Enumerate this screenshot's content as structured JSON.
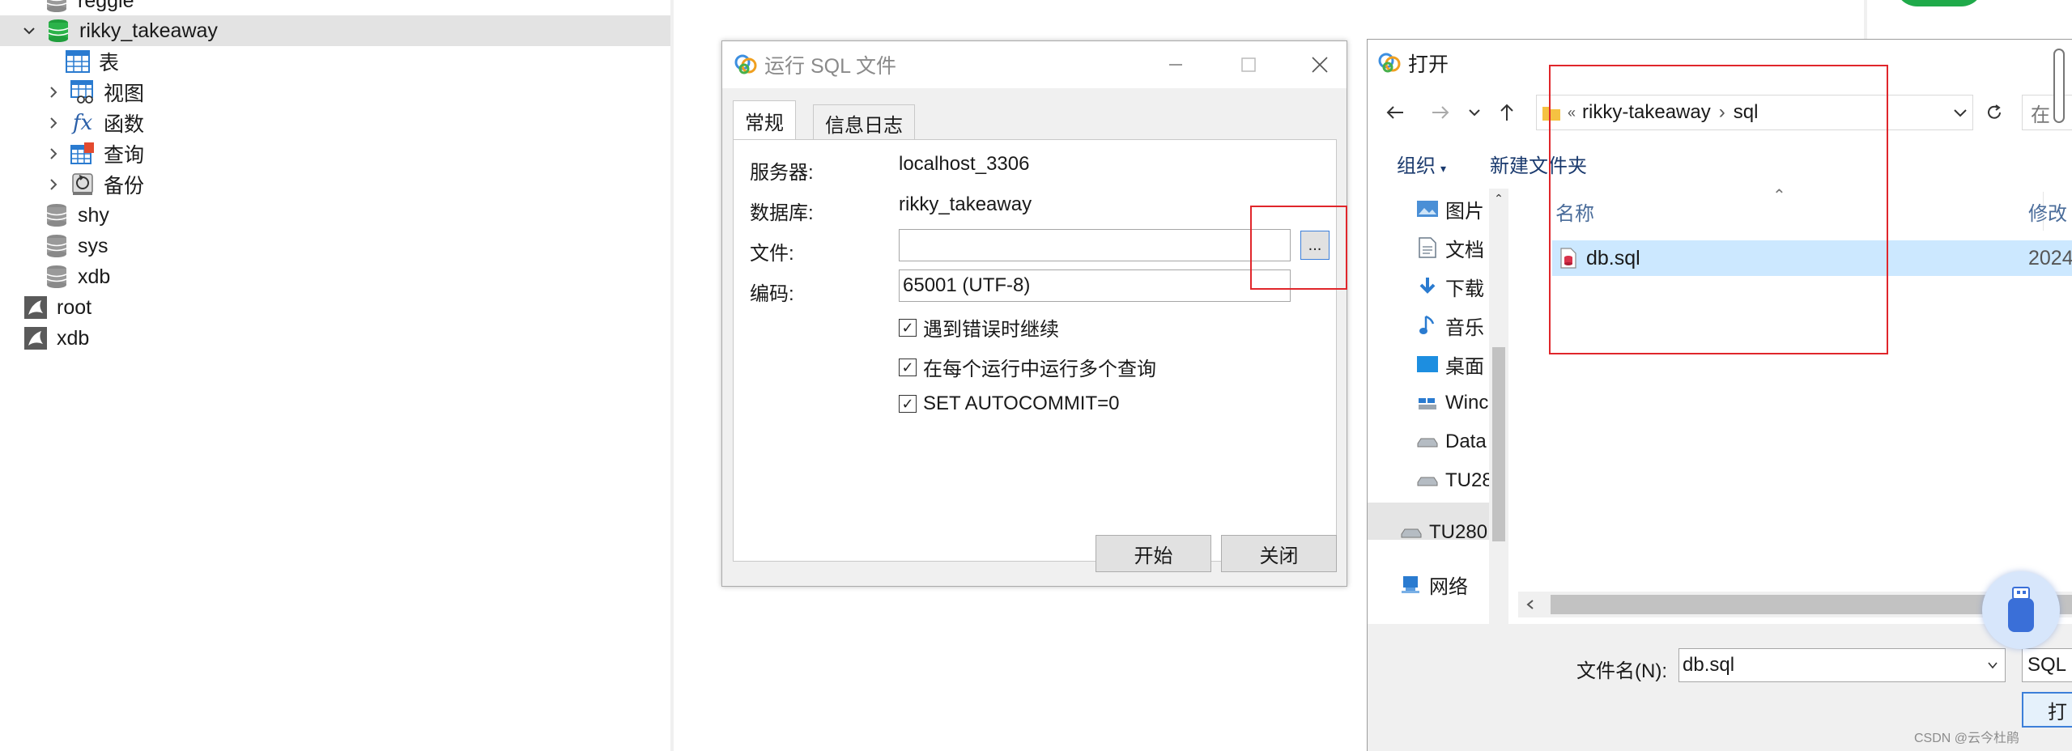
{
  "tree": {
    "items": [
      {
        "label": "reggie",
        "kind": "database"
      },
      {
        "label": "rikky_takeaway",
        "kind": "database-open"
      },
      {
        "label": "表",
        "kind": "table"
      },
      {
        "label": "视图",
        "kind": "view"
      },
      {
        "label": "函数",
        "kind": "function"
      },
      {
        "label": "查询",
        "kind": "query"
      },
      {
        "label": "备份",
        "kind": "backup"
      },
      {
        "label": "shy",
        "kind": "database"
      },
      {
        "label": "sys",
        "kind": "database"
      },
      {
        "label": "xdb",
        "kind": "database"
      },
      {
        "label": "root",
        "kind": "connection"
      },
      {
        "label": "xdb",
        "kind": "connection"
      }
    ]
  },
  "run_dialog": {
    "title": "运行 SQL 文件",
    "tabs": [
      "常规",
      "信息日志"
    ],
    "server_label": "服务器:",
    "server_value": "localhost_3306",
    "database_label": "数据库:",
    "database_value": "rikky_takeaway",
    "file_label": "文件:",
    "file_value": "",
    "browse_label": "...",
    "encoding_label": "编码:",
    "encoding_value": "65001 (UTF-8)",
    "options": [
      {
        "label": "遇到错误时继续",
        "checked": true
      },
      {
        "label": "在每个运行中运行多个查询",
        "checked": true
      },
      {
        "label": "SET AUTOCOMMIT=0",
        "checked": true
      }
    ],
    "start_button": "开始",
    "close_button": "关闭"
  },
  "open_dialog": {
    "title": "打开",
    "path": [
      "«",
      "rikky-takeaway",
      "sql"
    ],
    "search_placeholder": "在",
    "organize": "组织",
    "new_folder": "新建文件夹",
    "nav_items": [
      {
        "label": "图片",
        "icon": "pictures-icon"
      },
      {
        "label": "文档",
        "icon": "documents-icon"
      },
      {
        "label": "下载",
        "icon": "downloads-icon"
      },
      {
        "label": "音乐",
        "icon": "music-icon"
      },
      {
        "label": "桌面",
        "icon": "desktop-icon"
      },
      {
        "label": "Winc",
        "icon": "drive-icon"
      },
      {
        "label": "Data",
        "icon": "drive-icon"
      },
      {
        "label": "TU28",
        "icon": "drive-icon"
      },
      {
        "label": "TU280",
        "icon": "drive-icon"
      },
      {
        "label": "网络",
        "icon": "network-icon"
      }
    ],
    "col_name": "名称",
    "col_modified": "修改",
    "files": [
      {
        "name": "db.sql",
        "modified": "2024"
      }
    ],
    "filename_label": "文件名(N):",
    "filename_value": "db.sql",
    "filetype_value": "SQL",
    "open_button": "打"
  },
  "watermark": "CSDN @云今杜鹃"
}
